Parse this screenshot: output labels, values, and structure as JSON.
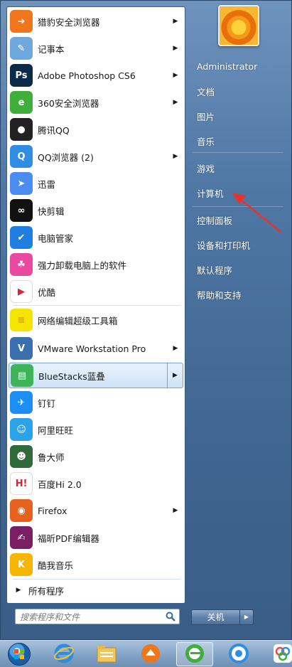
{
  "left_items": [
    {
      "label": "猎豹安全浏览器",
      "icon": "cheetah-browser-icon",
      "color": "#f0761c",
      "glyph": "➜",
      "arrow": true
    },
    {
      "label": "记事本",
      "icon": "notepad-icon",
      "color": "#6fa8dc",
      "glyph": "✎",
      "arrow": true
    },
    {
      "label": "Adobe Photoshop CS6",
      "icon": "photoshop-icon",
      "color": "#0b2a4a",
      "glyph": "Ps",
      "arrow": true
    },
    {
      "label": "360安全浏览器",
      "icon": "360-browser-icon",
      "color": "#3fae3a",
      "glyph": "e",
      "arrow": true
    },
    {
      "label": "腾讯QQ",
      "icon": "qq-penguin-icon",
      "color": "#222222",
      "glyph": "●",
      "arrow": false
    },
    {
      "label": "QQ浏览器 (2)",
      "icon": "qq-browser-icon",
      "color": "#2f8de4",
      "glyph": "Q",
      "arrow": true
    },
    {
      "label": "迅雷",
      "icon": "xunlei-icon",
      "color": "#4a8cf0",
      "glyph": "➤",
      "arrow": false
    },
    {
      "label": "快剪辑",
      "icon": "kuaijianji-icon",
      "color": "#111111",
      "glyph": "∞",
      "arrow": false
    },
    {
      "label": "电脑管家",
      "icon": "pc-manager-shield-icon",
      "color": "#1e7fe0",
      "glyph": "✔",
      "arrow": false
    },
    {
      "label": "强力卸载电脑上的软件",
      "icon": "uninstaller-icon",
      "color": "#e94aa0",
      "glyph": "☘",
      "arrow": false
    },
    {
      "label": "优酷",
      "icon": "youku-icon",
      "color": "#ffffff",
      "glyph": "▶",
      "arrow": false
    },
    {
      "label": "网络编辑超级工具箱",
      "icon": "toolbox-icon",
      "color": "#f5e300",
      "glyph": "≡",
      "arrow": false
    },
    {
      "label": "VMware Workstation Pro",
      "icon": "vmware-icon",
      "color": "#3a6fb0",
      "glyph": "V",
      "arrow": true
    },
    {
      "label": "BlueStacks蓝叠",
      "icon": "bluestacks-icon",
      "color": "#3db35a",
      "glyph": "▤",
      "arrow": true,
      "selected": true
    },
    {
      "label": "钉钉",
      "icon": "dingtalk-icon",
      "color": "#1d8ef5",
      "glyph": "✈",
      "arrow": false
    },
    {
      "label": "阿里旺旺",
      "icon": "aliwangwang-icon",
      "color": "#2aa3e8",
      "glyph": "☺",
      "arrow": false
    },
    {
      "label": "鲁大师",
      "icon": "ludashi-icon",
      "color": "#2f6a3a",
      "glyph": "☻",
      "arrow": false
    },
    {
      "label": "百度Hi 2.0",
      "icon": "baidu-hi-icon",
      "color": "#ffffff",
      "glyph": "H!",
      "arrow": false
    },
    {
      "label": "Firefox",
      "icon": "firefox-icon",
      "color": "#e8621f",
      "glyph": "◉",
      "arrow": true
    },
    {
      "label": "福昕PDF编辑器",
      "icon": "foxit-pdf-icon",
      "color": "#7a1f63",
      "glyph": "✍",
      "arrow": false
    },
    {
      "label": "酷我音乐",
      "icon": "kuwo-music-icon",
      "color": "#f7b500",
      "glyph": "K",
      "arrow": false
    }
  ],
  "all_programs": "所有程序",
  "search": {
    "placeholder": "搜索程序和文件"
  },
  "right_items": [
    {
      "label": "Administrator",
      "name": "user-name"
    },
    {
      "label": "文档",
      "name": "documents"
    },
    {
      "label": "图片",
      "name": "pictures"
    },
    {
      "label": "音乐",
      "name": "music"
    },
    {
      "label": "游戏",
      "name": "games"
    },
    {
      "label": "计算机",
      "name": "computer"
    },
    {
      "label": "控制面板",
      "name": "control-panel"
    },
    {
      "label": "设备和打印机",
      "name": "devices-and-printers"
    },
    {
      "label": "默认程序",
      "name": "default-programs"
    },
    {
      "label": "帮助和支持",
      "name": "help-and-support"
    }
  ],
  "shutdown": {
    "label": "关机"
  },
  "taskbar": [
    {
      "icon": "start-orb-icon"
    },
    {
      "icon": "ie-icon"
    },
    {
      "icon": "file-explorer-icon"
    },
    {
      "icon": "cheetah-browser-icon"
    },
    {
      "icon": "360-browser-icon",
      "active": true
    },
    {
      "icon": "qq-browser-icon"
    },
    {
      "icon": "app-icon"
    }
  ],
  "colors": {
    "annotation_arrow": "#e8322c",
    "menu_blue": "#4f77a4"
  }
}
